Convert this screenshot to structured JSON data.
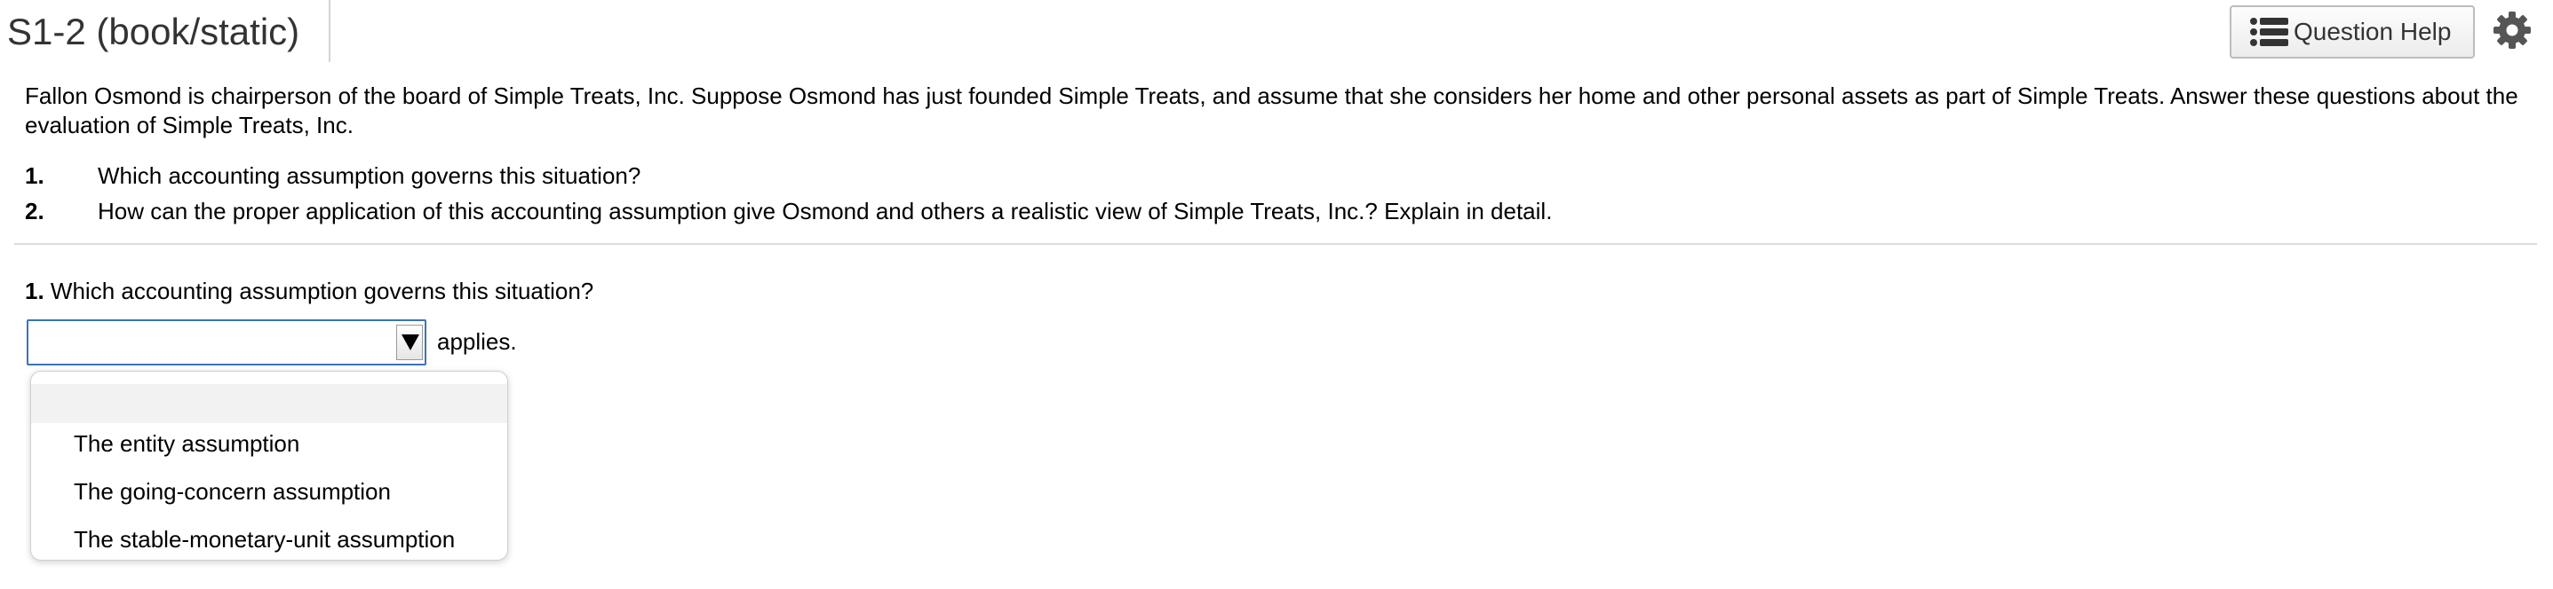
{
  "header": {
    "title": "S1-2 (book/static)",
    "help_button_label": "Question Help"
  },
  "problem": {
    "intro": "Fallon Osmond is chairperson of the board of Simple Treats, Inc. Suppose Osmond has just founded Simple Treats, and assume that she considers her home and other personal assets as part of Simple Treats. Answer these questions about the evaluation of Simple Treats, Inc.",
    "questions": [
      {
        "number": "1.",
        "text": "Which accounting assumption governs this situation?"
      },
      {
        "number": "2.",
        "text": "How can the proper application of this accounting assumption give Osmond and others a realistic view of Simple Treats, Inc.? Explain in detail."
      }
    ]
  },
  "part1": {
    "number": "1.",
    "prompt": "Which accounting assumption governs this situation?",
    "select_value": "",
    "suffix": "applies.",
    "options": [
      "",
      "The entity assumption",
      "The going-concern assumption",
      "The stable-monetary-unit assumption"
    ]
  },
  "colors": {
    "select_border": "#3b73b9",
    "title_text": "#333333"
  },
  "icons": {
    "help": "list-icon",
    "settings": "gear-icon",
    "dropdown": "dropdown-arrow-icon"
  }
}
